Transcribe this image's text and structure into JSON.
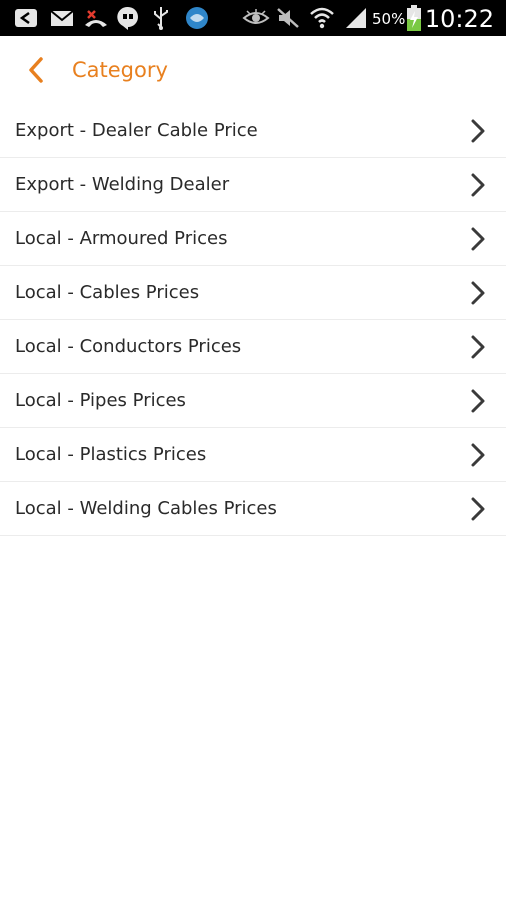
{
  "status_bar": {
    "battery_percent": "50%",
    "time": "10:22",
    "icons": [
      "app-icon",
      "mail-icon",
      "missed-call-icon",
      "hangouts-icon",
      "usb-icon",
      "browser-icon",
      "eye-icon",
      "mute-icon",
      "wifi-icon",
      "signal-icon",
      "battery-charging-icon"
    ]
  },
  "action_bar": {
    "title": "Category",
    "back_icon": "chevron-left-icon",
    "accent_color": "#e8801f"
  },
  "categories": [
    {
      "label": "Export - Dealer Cable Price"
    },
    {
      "label": "Export - Welding Dealer"
    },
    {
      "label": "Local - Armoured Prices"
    },
    {
      "label": "Local - Cables Prices"
    },
    {
      "label": "Local - Conductors Prices"
    },
    {
      "label": "Local - Pipes Prices"
    },
    {
      "label": "Local - Plastics Prices"
    },
    {
      "label": "Local - Welding Cables Prices"
    }
  ]
}
